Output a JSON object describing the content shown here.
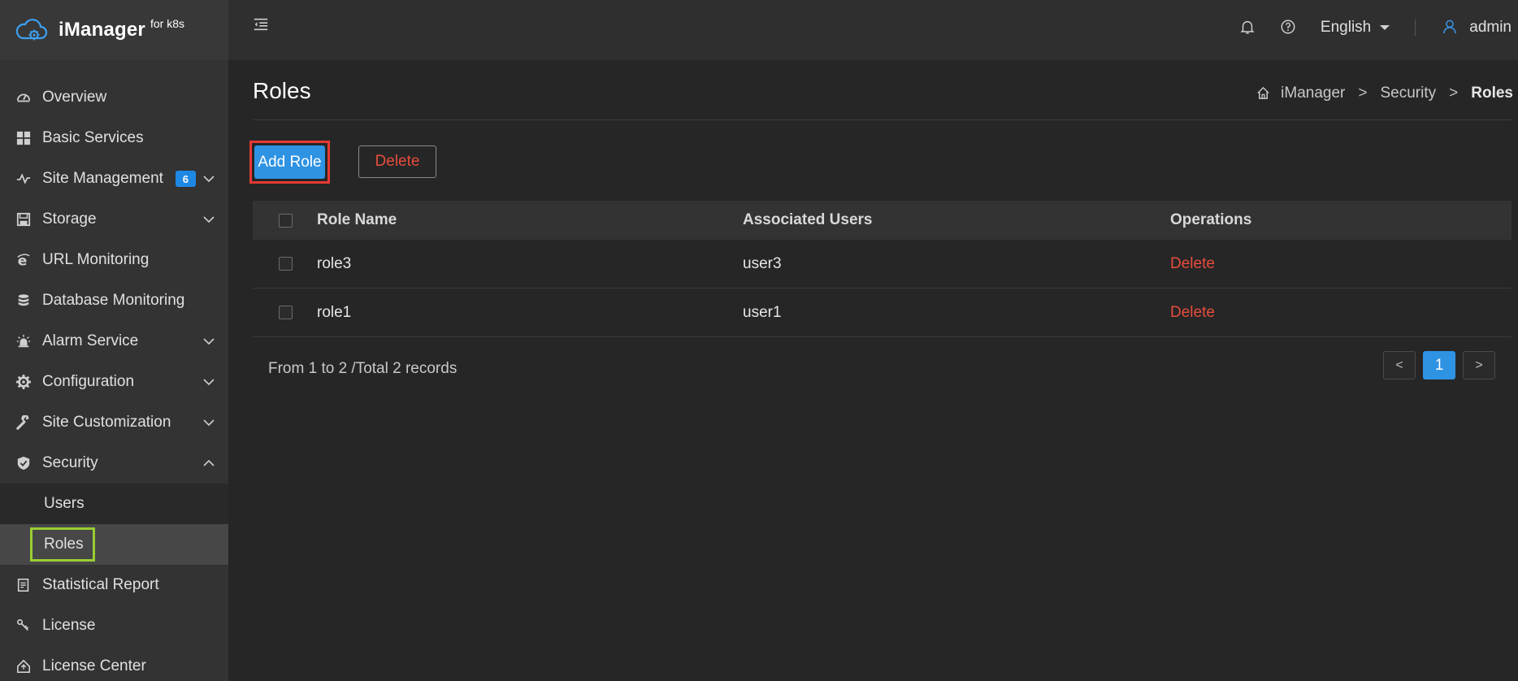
{
  "app": {
    "title": "iManager",
    "subtitle": "for k8s"
  },
  "topbar": {
    "language": "English",
    "user": "admin",
    "icons": [
      "menu-fold-icon",
      "bell-icon",
      "help-icon",
      "chevron-down-icon",
      "user-icon"
    ]
  },
  "sidebar": {
    "items": [
      {
        "label": "Overview",
        "icon": "dashboard-icon"
      },
      {
        "label": "Basic Services",
        "icon": "grid-icon"
      },
      {
        "label": "Site Management",
        "icon": "pulse-icon",
        "badge": "6"
      },
      {
        "label": "Storage",
        "icon": "storage-icon"
      },
      {
        "label": "URL Monitoring",
        "icon": "ie-icon"
      },
      {
        "label": "Database Monitoring",
        "icon": "database-icon"
      },
      {
        "label": "Alarm Service",
        "icon": "alarm-icon"
      },
      {
        "label": "Configuration",
        "icon": "gear-icon"
      },
      {
        "label": "Site Customization",
        "icon": "wrench-icon"
      },
      {
        "label": "Security",
        "icon": "shield-icon"
      },
      {
        "label": "Statistical Report",
        "icon": "report-icon"
      },
      {
        "label": "License",
        "icon": "license-icon"
      },
      {
        "label": "License Center",
        "icon": "license-center-icon"
      }
    ],
    "security_sub": [
      {
        "label": "Users"
      },
      {
        "label": "Roles"
      }
    ]
  },
  "page": {
    "title": "Roles",
    "breadcrumb": [
      "iManager",
      "Security",
      "Roles"
    ],
    "add_label": "Add Role",
    "delete_label": "Delete"
  },
  "table": {
    "headers": [
      "Role Name",
      "Associated Users",
      "Operations"
    ],
    "rows": [
      {
        "role": "role3",
        "users": "user3",
        "op": "Delete"
      },
      {
        "role": "role1",
        "users": "user1",
        "op": "Delete"
      }
    ]
  },
  "pagination": {
    "summary": "From 1 to 2 /Total 2 records",
    "prev": "<",
    "current": "1",
    "next": ">"
  },
  "colors": {
    "accent": "#2f93e4",
    "danger": "#e84c3d",
    "badge": "#1e88e5",
    "highlight_red": "#e53935",
    "highlight_green": "#9acd32"
  }
}
